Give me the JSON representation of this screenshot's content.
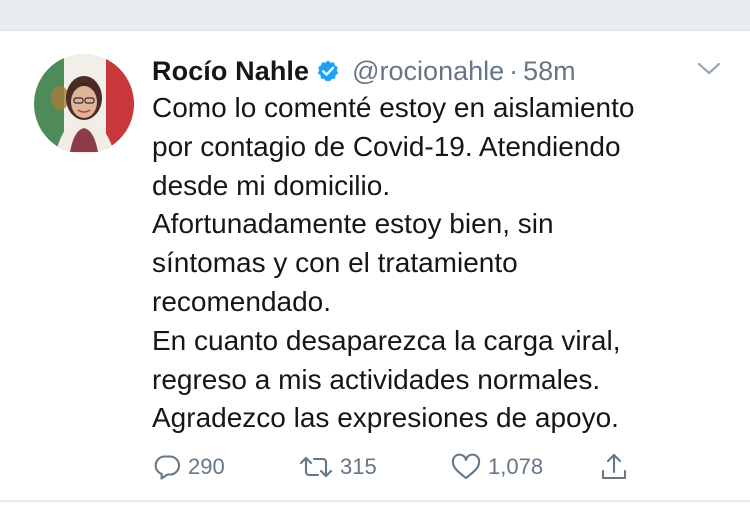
{
  "tweet": {
    "author_name": "Rocío Nahle",
    "handle": "@rocionahle",
    "separator": "·",
    "time": "58m",
    "lines": [
      "Como lo comenté estoy en aislamiento",
      "por contagio de Covid-19. Atendiendo",
      "desde mi domicilio.",
      "Afortunadamente estoy bien, sin",
      "síntomas y con el tratamiento",
      "recomendado.",
      "En cuanto desaparezca la carga viral,",
      "regreso a mis actividades normales.",
      "Agradezco las expresiones de apoyo."
    ]
  },
  "actions": {
    "reply_count": "290",
    "retweet_count": "315",
    "like_count": "1,078"
  },
  "icons": {
    "verified": "verified-badge-icon",
    "caret": "chevron-down-icon",
    "reply": "reply-icon",
    "retweet": "retweet-icon",
    "like": "heart-icon",
    "share": "share-icon"
  },
  "colors": {
    "text": "#14171a",
    "secondary": "#657786",
    "verified": "#1da1f2",
    "background_strip": "#e6ecf0"
  }
}
